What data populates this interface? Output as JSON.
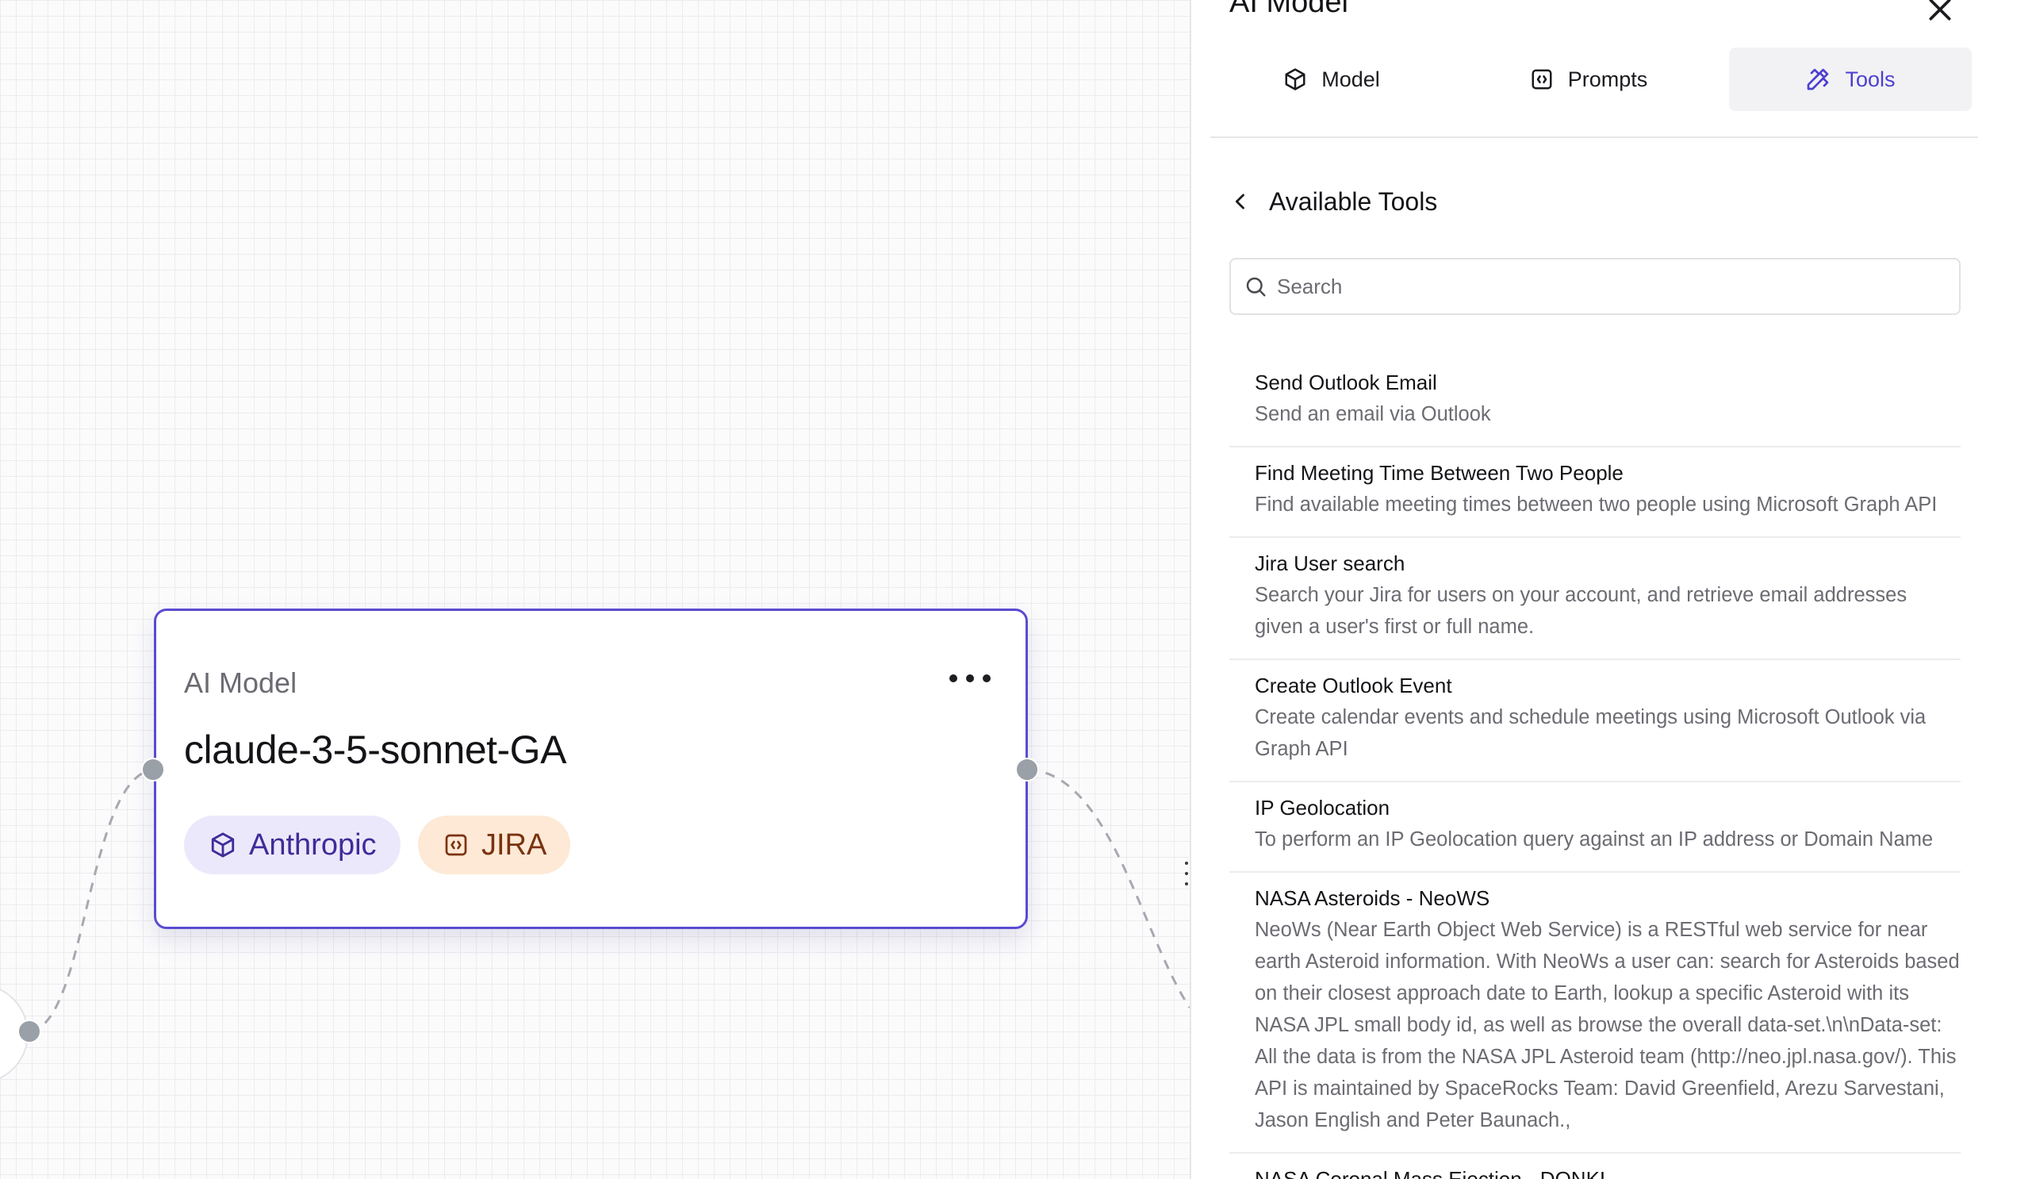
{
  "canvas": {
    "node": {
      "type_label": "AI Model",
      "model_name": "claude-3-5-sonnet-GA",
      "chips": [
        {
          "label": "Anthropic",
          "icon": "cube-icon"
        },
        {
          "label": "JIRA",
          "icon": "code-bracket-icon"
        }
      ]
    }
  },
  "panel": {
    "title": "AI Model",
    "tabs": [
      {
        "label": "Model",
        "icon": "cube-icon"
      },
      {
        "label": "Prompts",
        "icon": "code-bracket-icon"
      },
      {
        "label": "Tools",
        "icon": "tools-icon",
        "active": true
      }
    ],
    "section_title": "Available Tools",
    "search": {
      "placeholder": "Search",
      "value": ""
    },
    "tools": [
      {
        "name": "Send Outlook Email",
        "description": "Send an email via Outlook"
      },
      {
        "name": "Find Meeting Time Between Two People",
        "description": "Find available meeting times between two people using Microsoft Graph API"
      },
      {
        "name": "Jira User search",
        "description": "Search your Jira for users on your account, and retrieve email addresses given a user's first or full name."
      },
      {
        "name": "Create Outlook Event",
        "description": "Create calendar events and schedule meetings using Microsoft Outlook via Graph API"
      },
      {
        "name": "IP Geolocation",
        "description": "To perform an IP Geolocation query against an IP address or Domain Name"
      },
      {
        "name": "NASA Asteroids - NeoWS",
        "description": "NeoWs (Near Earth Object Web Service) is a RESTful web service for near earth Asteroid information. With NeoWs a user can: search for Asteroids based on their closest approach date to Earth, lookup a specific Asteroid with its NASA JPL small body id, as well as browse the overall data-set.\\n\\nData-set: All the data is from the NASA JPL Asteroid team (http://neo.jpl.nasa.gov/). This API is maintained by SpaceRocks Team: David Greenfield, Arezu Sarvestani, Jason English and Peter Baunach.,"
      },
      {
        "name": "NASA Coronal Mass Ejection - DONKI",
        "description": ""
      }
    ]
  },
  "colors": {
    "accent": "#5a4bd1",
    "tab_active_text": "#4d3fd0",
    "chip_anthropic_bg": "#ece8fb",
    "chip_jira_bg": "#fde9d6",
    "handle": "#9aa0a8"
  }
}
